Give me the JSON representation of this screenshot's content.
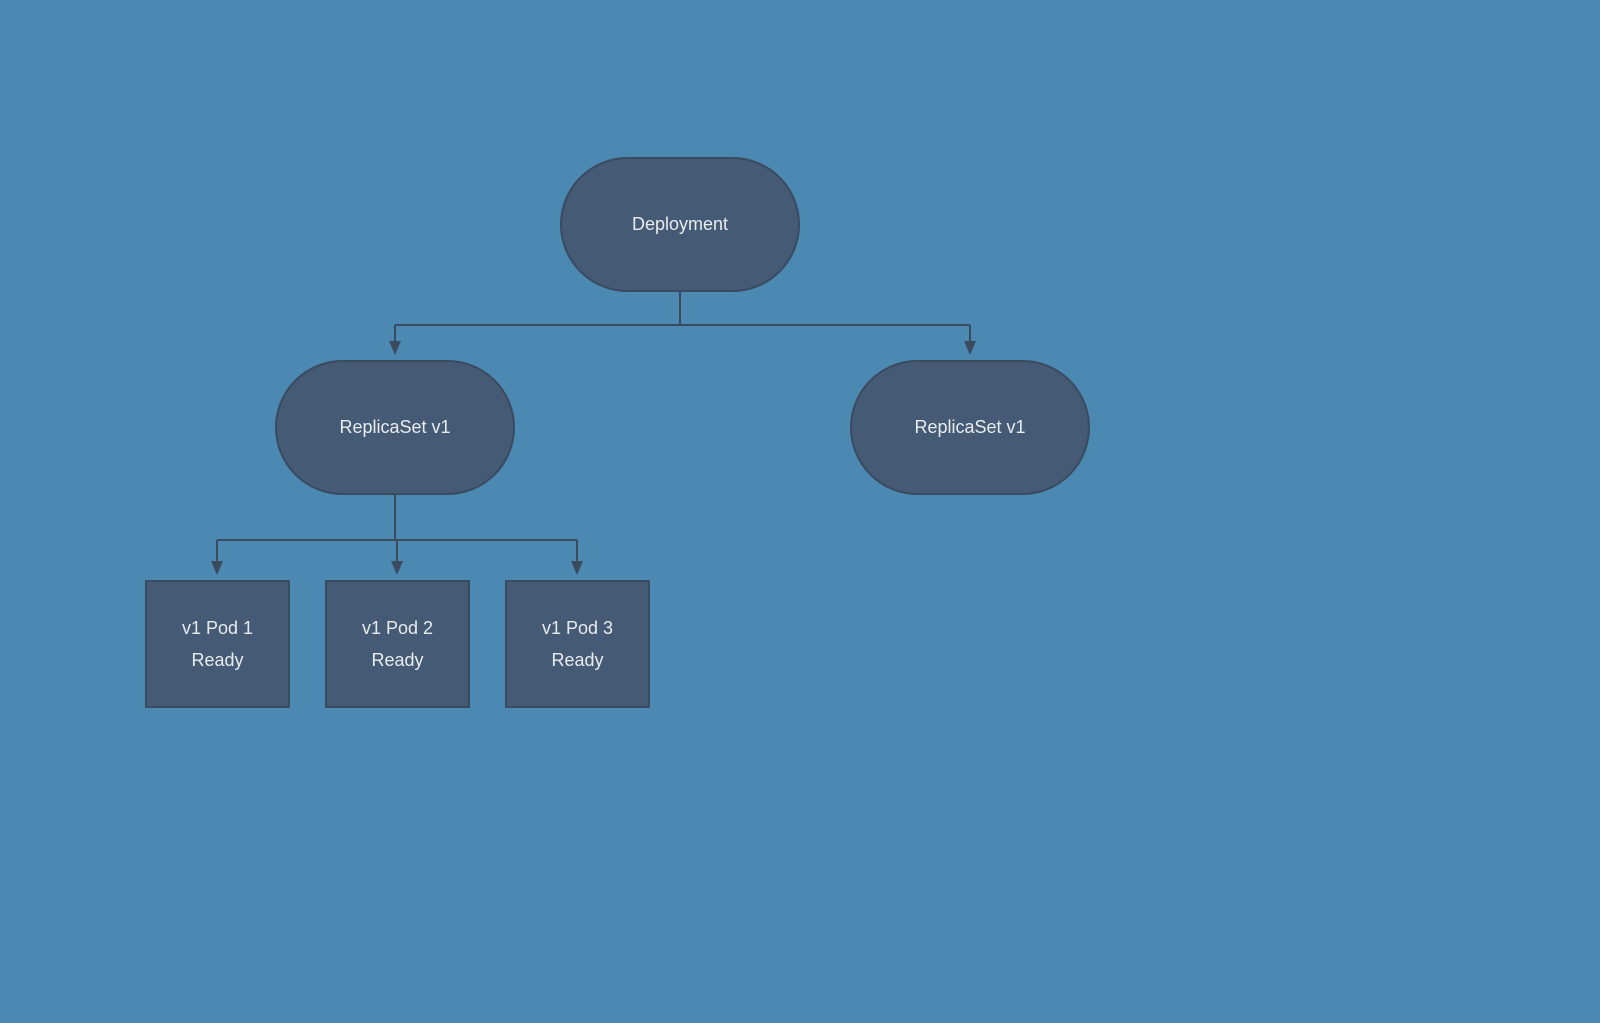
{
  "nodes": {
    "deployment": {
      "label": "Deployment"
    },
    "replicaset_left": {
      "label": "ReplicaSet v1"
    },
    "replicaset_right": {
      "label": "ReplicaSet v1"
    },
    "pod1": {
      "line1": "v1 Pod 1",
      "line2": "Ready"
    },
    "pod2": {
      "line1": "v1 Pod 2",
      "line2": "Ready"
    },
    "pod3": {
      "line1": "v1 Pod 3",
      "line2": "Ready"
    }
  }
}
